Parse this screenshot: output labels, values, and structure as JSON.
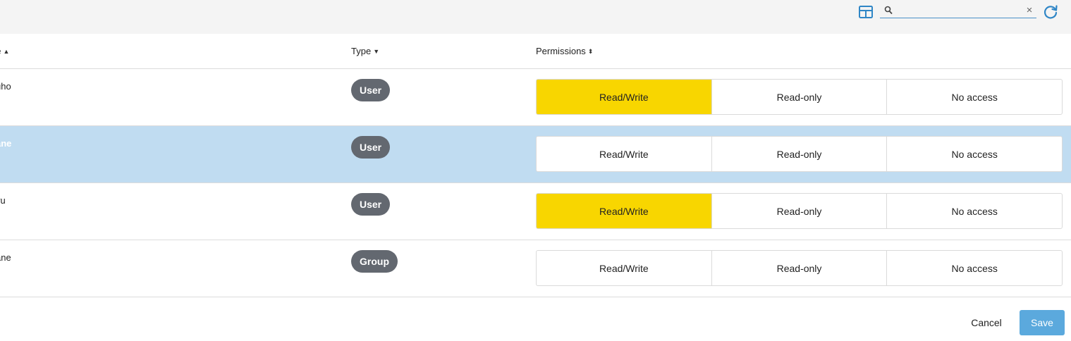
{
  "toolbar": {
    "grid_icon": "grid-view-icon",
    "search": {
      "value": "",
      "placeholder": ""
    },
    "clear_label": "×",
    "refresh_icon": "refresh-icon",
    "accent": "#4a90c8"
  },
  "table": {
    "columns": [
      {
        "label": "ne",
        "sort": "asc"
      },
      {
        "label": "Type",
        "sort": "desc"
      },
      {
        "label": "Permissions",
        "sort": "both"
      }
    ],
    "sort_glyphs": {
      "asc": "▲",
      "desc": "▼",
      "both": "⬍"
    },
    "permission_options": [
      "Read/Write",
      "Read-only",
      "No access"
    ],
    "rows": [
      {
        "name": "uho",
        "type": "User",
        "permission": "Read/Write",
        "selected": false
      },
      {
        "name": "ane",
        "type": "User",
        "permission": "",
        "selected": true
      },
      {
        "name": "yu",
        "type": "User",
        "permission": "Read/Write",
        "selected": false
      },
      {
        "name": "ane",
        "type": "Group",
        "permission": "",
        "selected": false
      }
    ]
  },
  "footer": {
    "cancel_label": "Cancel",
    "save_label": "Save"
  },
  "colors": {
    "active_permission": "#f8d600",
    "selected_row": "#c0dcf1",
    "badge": "#636870",
    "save_button": "#5ba9dd"
  }
}
